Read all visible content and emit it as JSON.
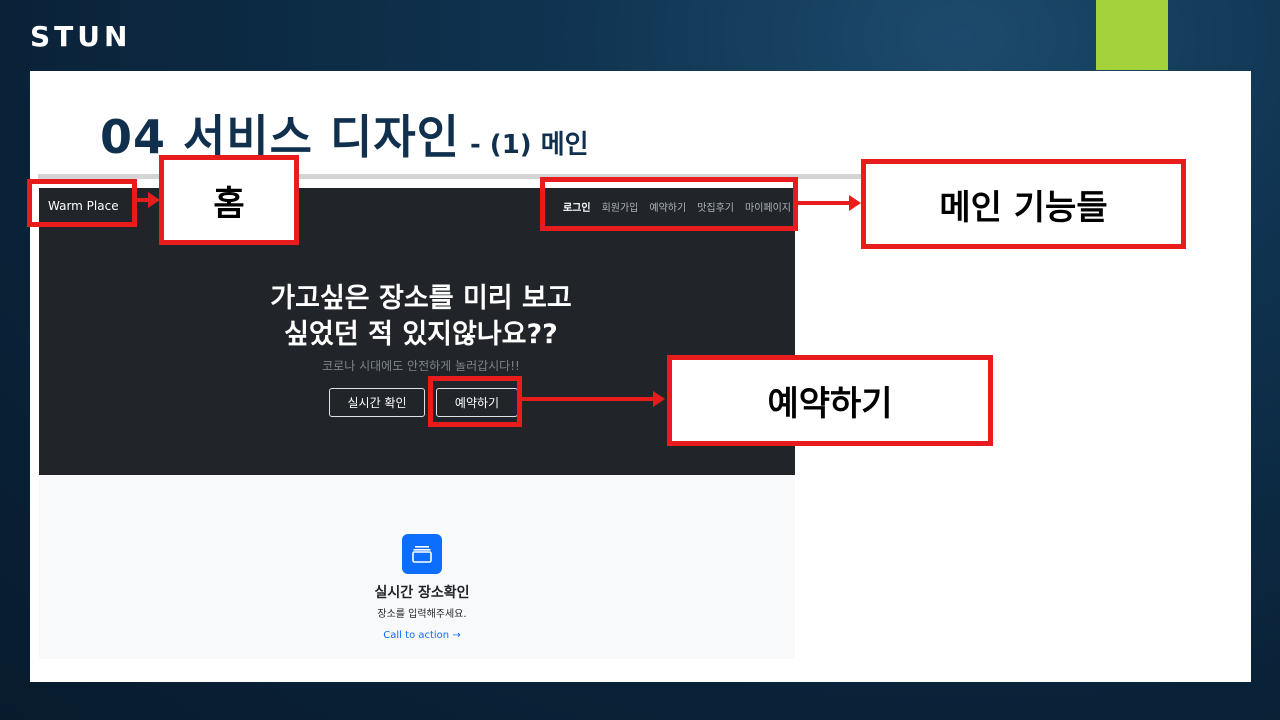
{
  "header": {
    "brand": "STUN",
    "accent_color": "#a4d23a"
  },
  "slide": {
    "title": "04 서비스 디자인",
    "subtitle": "- (1) 메인"
  },
  "site": {
    "brand": "Warm Place",
    "nav": [
      "로그인",
      "회원가입",
      "예약하기",
      "맛집후기",
      "마이페이지"
    ],
    "hero": {
      "headline_line1": "가고싶은 장소를 미리 보고",
      "headline_line2": "싶었던 적 있지않나요??",
      "subtext": "코로나 시대에도 안전하게 놀러갑시다!!",
      "btn_realtime": "실시간 확인",
      "btn_reserve": "예약하기"
    },
    "feature": {
      "icon": "collection-icon",
      "title": "실시간 장소확인",
      "desc": "장소를 입력해주세요.",
      "link": "Call to action →"
    }
  },
  "annotations": {
    "home": "홈",
    "main_features": "메인 기능들",
    "reserve": "예약하기",
    "color": "#e81c1c"
  }
}
